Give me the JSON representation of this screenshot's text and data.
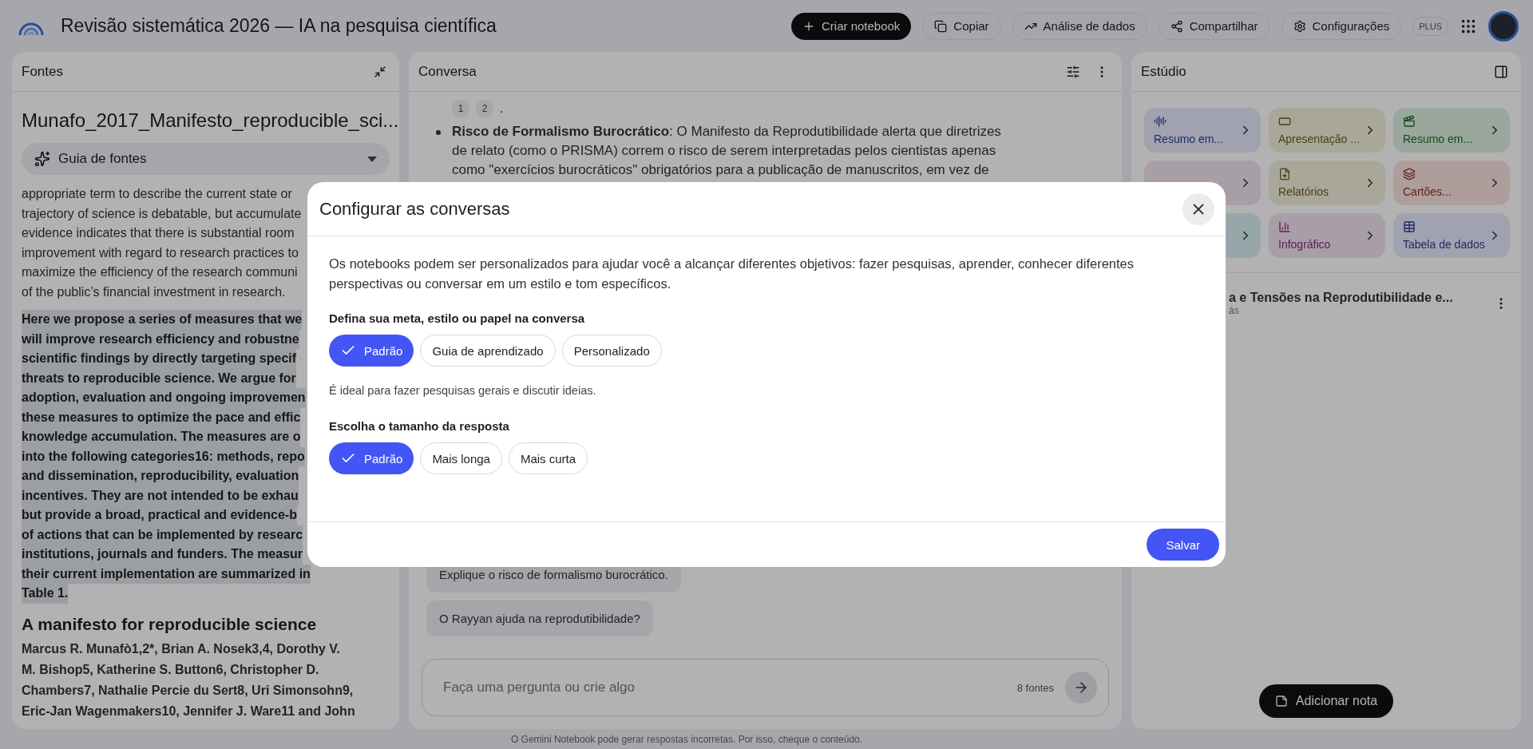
{
  "app_bar": {
    "title": "Revisão sistemática 2026 — IA na pesquisa científica",
    "actions": [
      {
        "kind": "primary",
        "label": "Criar notebook"
      },
      {
        "kind": "outline",
        "label": "Copiar"
      },
      {
        "kind": "outline",
        "label": "Análise de dados"
      },
      {
        "kind": "outline",
        "label": "Compartilhar"
      },
      {
        "kind": "outline",
        "label": "Configurações"
      }
    ],
    "badge": "PLUS"
  },
  "sources_panel": {
    "title": "Fontes",
    "source_title": "Munafo_2017_Manifesto_reproducible_sci...",
    "guide": {
      "label": "Guia de fontes",
      "expanded": false
    },
    "paragraphs": [
      {
        "kind": "plain",
        "lines": [
          "appropriate term to describe the current state or",
          "trajectory of science is debatable, but accumulate",
          "evidence indicates that there is substantial room",
          "improvement with regard to research practices to",
          "maximize the efficiency of the research communi",
          "of the public’s financial investment in research."
        ]
      },
      {
        "kind": "highlight",
        "lines": [
          "Here we propose a series of measures that we",
          "will improve research efficiency and robustne",
          "scientific findings by directly targeting specif",
          "threats to reproducible science. We argue for",
          "adoption, evaluation and ongoing improvemen",
          "these measures to optimize the pace and effic",
          "knowledge accumulation. The measures are o",
          "into the following categories16: methods, repo",
          "and dissemination, reproducibility, evaluation",
          "incentives. They are not intended to be exhau",
          "but provide a broad, practical and evidence-b",
          "of actions that can be implemented by researc",
          "institutions, journals and funders. The measur",
          "their current implementation are summarized in",
          "Table 1."
        ]
      }
    ],
    "heading": "A manifesto for reproducible science",
    "authors": [
      "Marcus R. Munafò1,2*, Brian A. Nosek3,4, Dorothy V.",
      "M. Bishop5, Katherine S. Button6, Christopher D.",
      "Chambers7, Nathalie Percie du Sert8, Uri Simonsohn9,",
      "Eric-Jan Wagenmakers10, Jennifer J. Ware11 and John"
    ]
  },
  "chat_panel": {
    "title": "Conversa",
    "citations": [
      "1",
      "2"
    ],
    "citation_end": ".",
    "bullets": [
      "**Risco de Formalismo Burocrático**: O Manifesto da Reprodutibilidade alerta que diretrizes de relato (como o PRISMA) correm o risco de serem interpretadas pelos cientistas apenas como \"exercícios burocráticos\" obrigatórios para a publicação de manuscritos, em vez de"
    ],
    "suggestions": [
      "Explique o risco de formalismo burocrático.",
      "O Rayyan ajuda na reprodutibilidade?"
    ],
    "input": {
      "placeholder": "Faça uma pergunta ou crie algo",
      "source_count": "8 fontes"
    }
  },
  "studio_panel": {
    "title": "Estúdio",
    "tiles": [
      {
        "kind": "audio",
        "label": "Resumo em..."
      },
      {
        "kind": "slides",
        "label": "Apresentação ..."
      },
      {
        "kind": "video",
        "label": "Resumo em..."
      },
      {
        "kind": "mindmap"
      },
      {
        "kind": "report",
        "label": "Relatórios"
      },
      {
        "kind": "flashcards",
        "label": "Cartões..."
      },
      {
        "kind": "other"
      },
      {
        "kind": "infographic",
        "label": "Infográfico"
      },
      {
        "kind": "table",
        "label": "Tabela de dados"
      }
    ],
    "notes": [
      {
        "title": "a e Tensões na Reprodutibilidade e...",
        "meta": "ás"
      }
    ],
    "add_note": "Adicionar nota"
  },
  "dialog": {
    "title": "Configurar as conversas",
    "description": "Os notebooks podem ser personalizados para ajudar você a alcançar diferentes objetivos: fazer pesquisas, aprender, conhecer diferentes perspectivas ou conversar em um estilo e tom específicos.",
    "goal": {
      "label": "Defina sua meta, estilo ou papel na conversa",
      "options": [
        {
          "label": "Padrão",
          "selected": true
        },
        {
          "label": "Guia de aprendizado",
          "selected": false
        },
        {
          "label": "Personalizado",
          "selected": false
        }
      ]
    },
    "hint": "É ideal para fazer pesquisas gerais e discutir ideias.",
    "length": {
      "label": "Escolha o tamanho da resposta",
      "options": [
        {
          "label": "Padrão",
          "selected": true
        },
        {
          "label": "Mais longa",
          "selected": false
        },
        {
          "label": "Mais curta",
          "selected": false
        }
      ]
    },
    "save": "Salvar"
  },
  "footer": "O Gemini Notebook pode gerar respostas incorretas. Por isso, cheque o conteúdo."
}
